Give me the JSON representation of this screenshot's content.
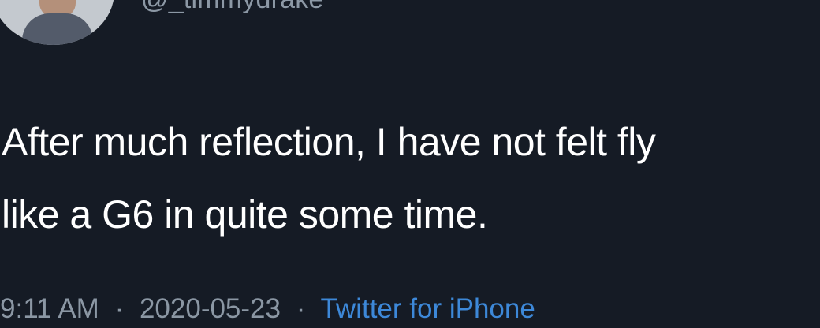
{
  "tweet": {
    "handle": "@_timmydrake",
    "text_lines": [
      "After much reflection, I have not felt fly",
      "like a G6 in quite some time."
    ],
    "time": "9:11 AM",
    "date": "2020-05-23",
    "separator": "·",
    "source": "Twitter for iPhone"
  },
  "colors": {
    "background": "#151b25",
    "text": "#ffffff",
    "secondary_text": "#8b97a4",
    "link": "#3d88d8"
  },
  "icons": {
    "avatar": "profile-photo"
  }
}
